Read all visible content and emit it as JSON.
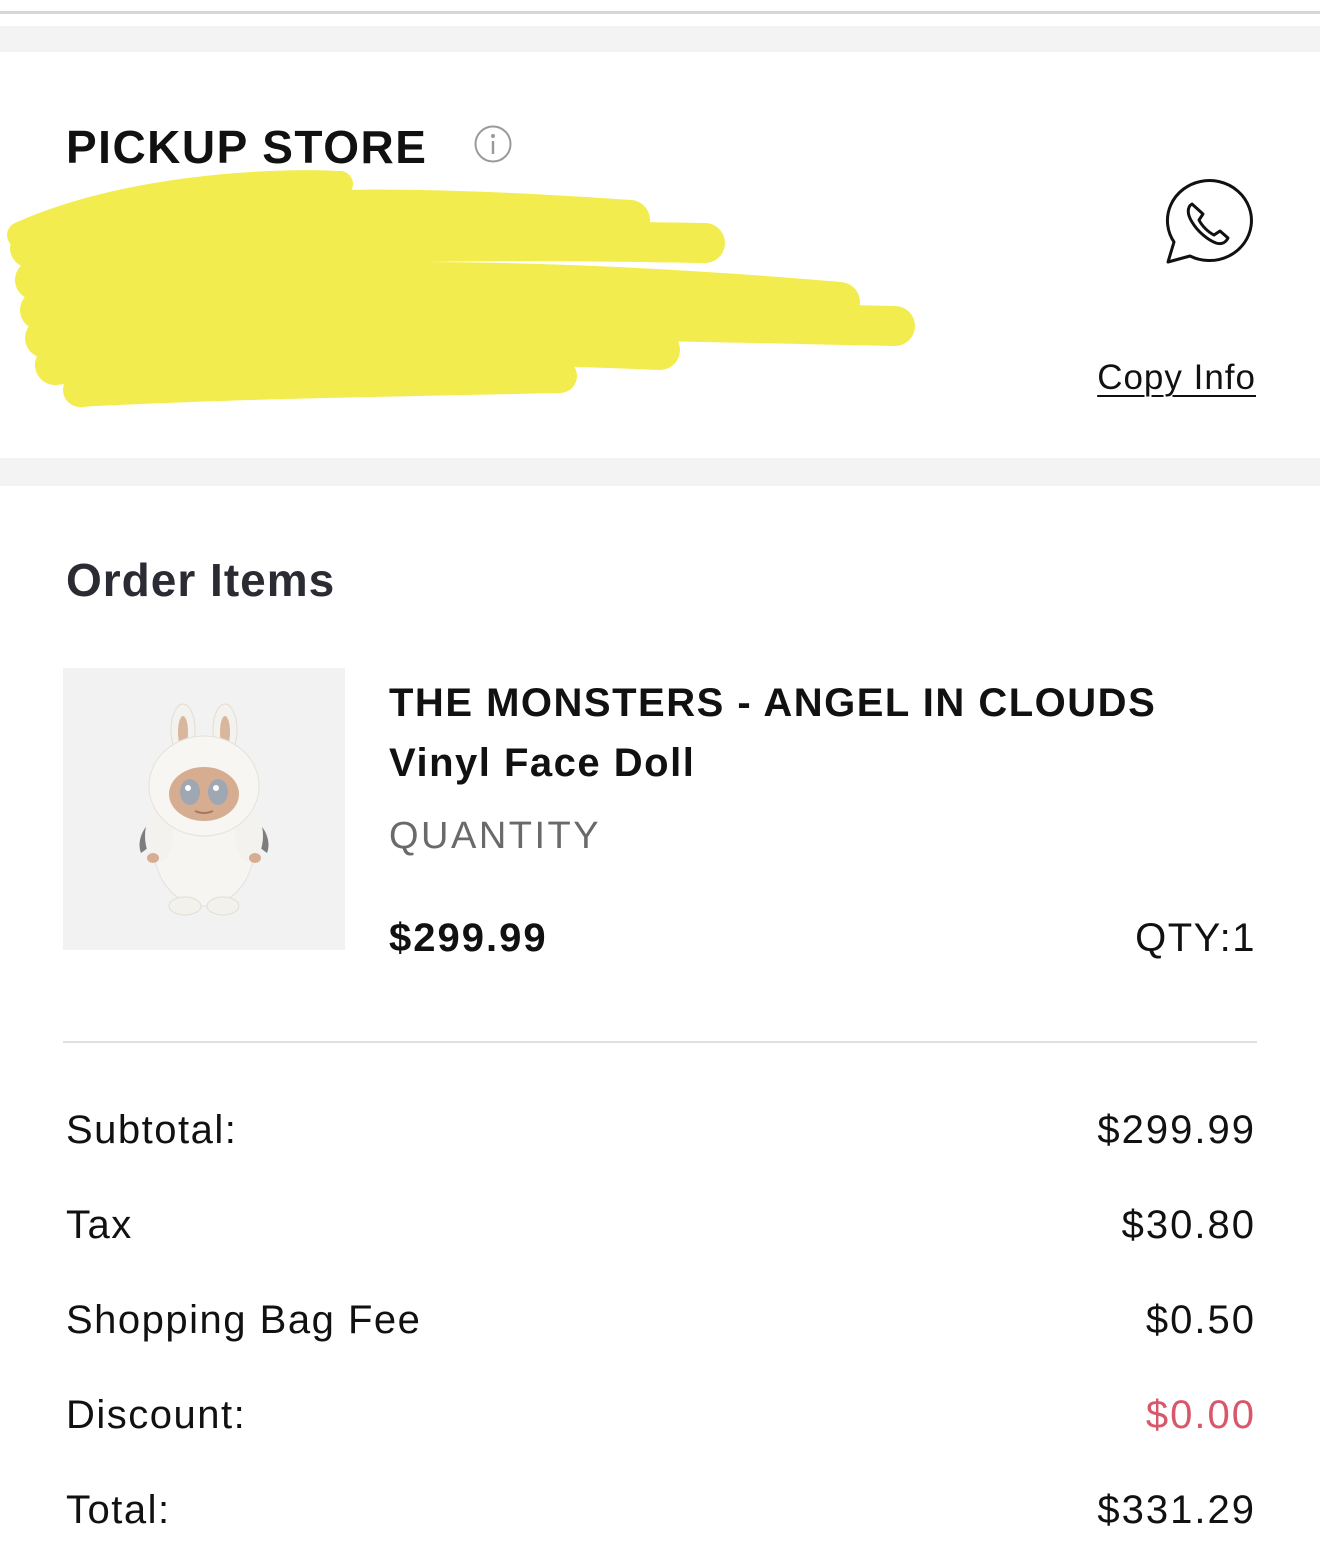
{
  "pickup": {
    "title": "PICKUP STORE",
    "copy_label": "Copy Info",
    "icons": [
      "info-icon",
      "whatsapp-phone-icon"
    ]
  },
  "order": {
    "heading": "Order Items",
    "item": {
      "name": "THE MONSTERS - ANGEL IN CLOUDS Vinyl Face Doll",
      "quantity_label": "QUANTITY",
      "price": "$299.99",
      "qty": "QTY:1"
    }
  },
  "summary": {
    "subtotal_label": "Subtotal:",
    "subtotal_value": "$299.99",
    "tax_label": "Tax",
    "tax_value": "$30.80",
    "bag_fee_label": "Shopping Bag Fee",
    "bag_fee_value": "$0.50",
    "discount_label": "Discount:",
    "discount_value": "$0.00",
    "total_label": "Total:",
    "total_value": "$331.29"
  },
  "colors": {
    "discount": "#d9576a",
    "redaction": "#f2ec4f",
    "section_band": "#f3f3f4"
  }
}
